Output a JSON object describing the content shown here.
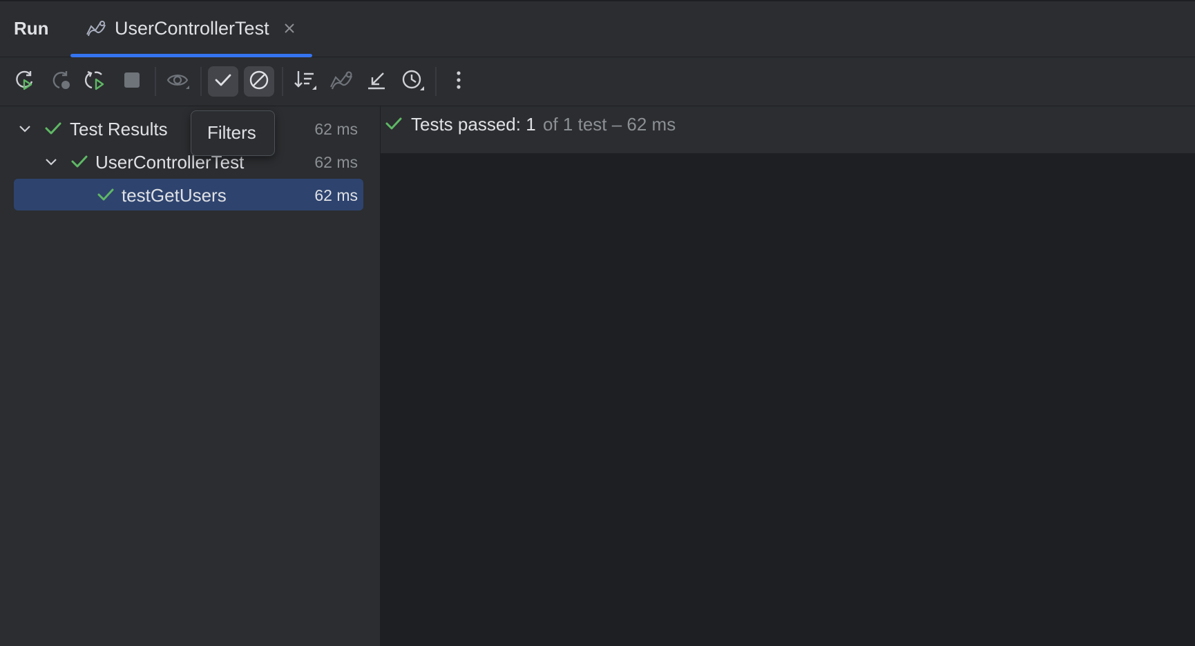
{
  "header": {
    "run_label": "Run",
    "tab_title": "UserControllerTest",
    "tab_icon": "test-config-icon",
    "accent": "#3574f0"
  },
  "toolbar": {
    "buttons": [
      {
        "name": "rerun-icon"
      },
      {
        "name": "rerun-failed-icon"
      },
      {
        "name": "toggle-auto-test-icon"
      },
      {
        "name": "stop-icon"
      },
      {
        "name": "show-passed-eye-icon"
      },
      {
        "name": "show-passed-check-icon",
        "active": true
      },
      {
        "name": "show-ignored-icon",
        "active": true
      },
      {
        "name": "sort-icon"
      },
      {
        "name": "import-tests-icon"
      },
      {
        "name": "export-icon"
      },
      {
        "name": "history-icon"
      },
      {
        "name": "more-options-icon"
      }
    ],
    "tooltip": "Filters"
  },
  "tree": {
    "items": [
      {
        "label": "Test Results",
        "time": "62 ms",
        "level": 0,
        "expanded": true
      },
      {
        "label": "UserControllerTest",
        "time": "62 ms",
        "level": 1,
        "expanded": true
      },
      {
        "label": "testGetUsers",
        "time": "62 ms",
        "level": 2,
        "selected": true
      }
    ],
    "check_color": "#5fb865",
    "selected_color": "#2e436e"
  },
  "console": {
    "status_strong": "Tests passed: 1",
    "status_rest": "of 1 test – 62 ms"
  }
}
